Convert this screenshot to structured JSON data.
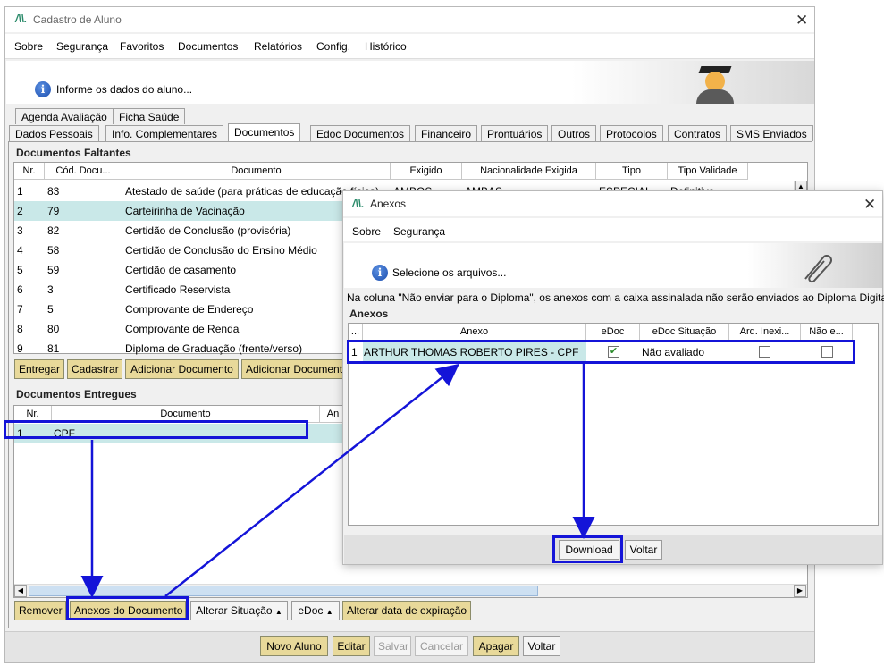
{
  "main_window": {
    "title": "Cadastro de Aluno",
    "menu": [
      "Sobre",
      "Segurança",
      "Favoritos",
      "Documentos",
      "Relatórios",
      "Config.",
      "Histórico"
    ],
    "info_text": "Informe os dados do aluno...",
    "tabs_row1": [
      "Agenda Avaliação",
      "Ficha Saúde"
    ],
    "tabs_row2": [
      "Dados Pessoais",
      "Info. Complementares",
      "Documentos",
      "Edoc Documentos",
      "Financeiro",
      "Prontuários",
      "Outros",
      "Protocolos",
      "Contratos",
      "SMS Enviados"
    ],
    "active_tab": "Documentos",
    "faltantes": {
      "label": "Documentos Faltantes",
      "columns": [
        "Nr.",
        "Cód. Docu...",
        "Documento",
        "Exigido",
        "Nacionalidade Exigida",
        "Tipo",
        "Tipo Validade"
      ],
      "rows": [
        [
          "1",
          "83",
          "Atestado de saúde (para práticas de educação física)",
          "AMBOS",
          "AMBAS",
          "ESPECIAL",
          "Definitivo"
        ],
        [
          "2",
          "79",
          "Carteirinha de Vacinação",
          "",
          "",
          "",
          ""
        ],
        [
          "3",
          "82",
          "Certidão de Conclusão (provisória)",
          "",
          "",
          "",
          ""
        ],
        [
          "4",
          "58",
          "Certidão de Conclusão do Ensino Médio",
          "",
          "",
          "",
          ""
        ],
        [
          "5",
          "59",
          "Certidão de casamento",
          "",
          "",
          "",
          ""
        ],
        [
          "6",
          "3",
          "Certificado Reservista",
          "",
          "",
          "",
          ""
        ],
        [
          "7",
          "5",
          "Comprovante de Endereço",
          "",
          "",
          "",
          ""
        ],
        [
          "8",
          "80",
          "Comprovante de Renda",
          "",
          "",
          "",
          ""
        ],
        [
          "9",
          "81",
          "Diploma de Graduação (frente/verso)",
          "",
          "",
          "",
          ""
        ]
      ],
      "buttons": [
        "Entregar",
        "Cadastrar",
        "Adicionar Documento",
        "Adicionar Document"
      ]
    },
    "entregues": {
      "label": "Documentos Entregues",
      "columns": [
        "Nr.",
        "Documento",
        "An"
      ],
      "rows": [
        [
          "1",
          "CPF"
        ]
      ],
      "buttons": [
        "Remover",
        "Anexos do Documento",
        "Alterar Situação",
        "eDoc",
        "Alterar data de expiração"
      ]
    },
    "footer_buttons": [
      "Novo Aluno",
      "Editar",
      "Salvar",
      "Cancelar",
      "Apagar",
      "Voltar"
    ]
  },
  "dialog": {
    "title": "Anexos",
    "menu": [
      "Sobre",
      "Segurança"
    ],
    "info_text": "Selecione os arquivos...",
    "note": "Na coluna \"Não enviar para o Diploma\", os anexos com a caixa assinalada não serão enviados ao Diploma Digital.",
    "group_label": "Anexos",
    "columns": [
      "...",
      "Anexo",
      "eDoc",
      "eDoc Situação",
      "Arq. Inexi...",
      "Não e..."
    ],
    "rows": [
      {
        "nr": "1",
        "anexo": "ARTHUR THOMAS ROBERTO PIRES - CPF",
        "edoc": true,
        "situacao": "Não avaliado",
        "arq_inexistente": false,
        "nao_enviar": false
      }
    ],
    "buttons": [
      "Download",
      "Voltar"
    ]
  },
  "colors": {
    "highlight": "#1414d8",
    "selected_row": "#c9e8e8",
    "button_bg": "#e8d99a"
  }
}
